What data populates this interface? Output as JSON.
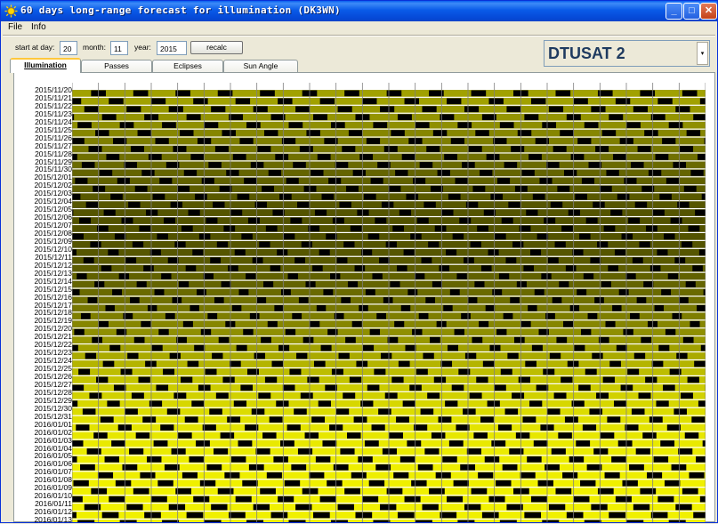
{
  "window": {
    "title": "60 days long-range forecast for illumination (DK3WN)",
    "minimize_glyph": "_",
    "maximize_glyph": "□",
    "close_glyph": "✕"
  },
  "menu": {
    "file": "File",
    "info": "Info"
  },
  "form": {
    "start_day_label": "start at day:",
    "start_day_value": "20",
    "month_label": "month:",
    "month_value": "11",
    "year_label": "year:",
    "year_value": "2015",
    "recalc_label": "recalc"
  },
  "satellite": {
    "selected": "DTUSAT 2",
    "dropdown_glyph": "▾"
  },
  "tabs": [
    {
      "label": "Illumination",
      "active": true
    },
    {
      "label": "Passes",
      "active": false
    },
    {
      "label": "Eclipses",
      "active": false
    },
    {
      "label": "Sun Angle",
      "active": false
    }
  ],
  "colors": {
    "illuminated": "#E0E000",
    "eclipse": "#000000",
    "grid": "#808080",
    "accent": "#0A5BE8"
  },
  "chart_data": {
    "type": "heatmap",
    "rows": [
      "2015/11/20",
      "2015/11/21",
      "2015/11/22",
      "2015/11/23",
      "2015/11/24",
      "2015/11/25",
      "2015/11/26",
      "2015/11/27",
      "2015/11/28",
      "2015/11/29",
      "2015/11/30",
      "2015/12/01",
      "2015/12/02",
      "2015/12/03",
      "2015/12/04",
      "2015/12/05",
      "2015/12/06",
      "2015/12/07",
      "2015/12/08",
      "2015/12/09",
      "2015/12/10",
      "2015/12/11",
      "2015/12/12",
      "2015/12/13",
      "2015/12/14",
      "2015/12/15",
      "2015/12/16",
      "2015/12/17",
      "2015/12/18",
      "2015/12/19",
      "2015/12/20",
      "2015/12/21",
      "2015/12/22",
      "2015/12/23",
      "2015/12/24",
      "2015/12/25",
      "2015/12/26",
      "2015/12/27",
      "2015/12/28",
      "2015/12/29",
      "2015/12/30",
      "2015/12/31",
      "2016/01/01",
      "2016/01/02",
      "2016/01/03",
      "2016/01/04",
      "2016/01/05",
      "2016/01/06",
      "2016/01/07",
      "2016/01/08",
      "2016/01/09",
      "2016/01/10",
      "2016/01/11",
      "2016/01/12",
      "2016/01/13"
    ],
    "orbits_per_day": 15,
    "eclipse_fraction_start": 0.35,
    "eclipse_fraction_mid": 0.22,
    "eclipse_fraction_end": 0.4,
    "illumination_intensity": [
      0.55,
      0.55,
      0.5,
      0.48,
      0.45,
      0.4,
      0.36,
      0.32,
      0.28,
      0.25,
      0.22,
      0.2,
      0.18,
      0.16,
      0.14,
      0.13,
      0.12,
      0.12,
      0.12,
      0.13,
      0.14,
      0.16,
      0.18,
      0.2,
      0.22,
      0.25,
      0.28,
      0.32,
      0.36,
      0.4,
      0.45,
      0.5,
      0.55,
      0.6,
      0.65,
      0.7,
      0.74,
      0.78,
      0.81,
      0.84,
      0.87,
      0.89,
      0.91,
      0.93,
      0.94,
      0.95,
      0.96,
      0.97,
      0.97,
      0.98,
      0.98,
      0.98,
      0.98,
      0.98,
      0.98
    ]
  }
}
